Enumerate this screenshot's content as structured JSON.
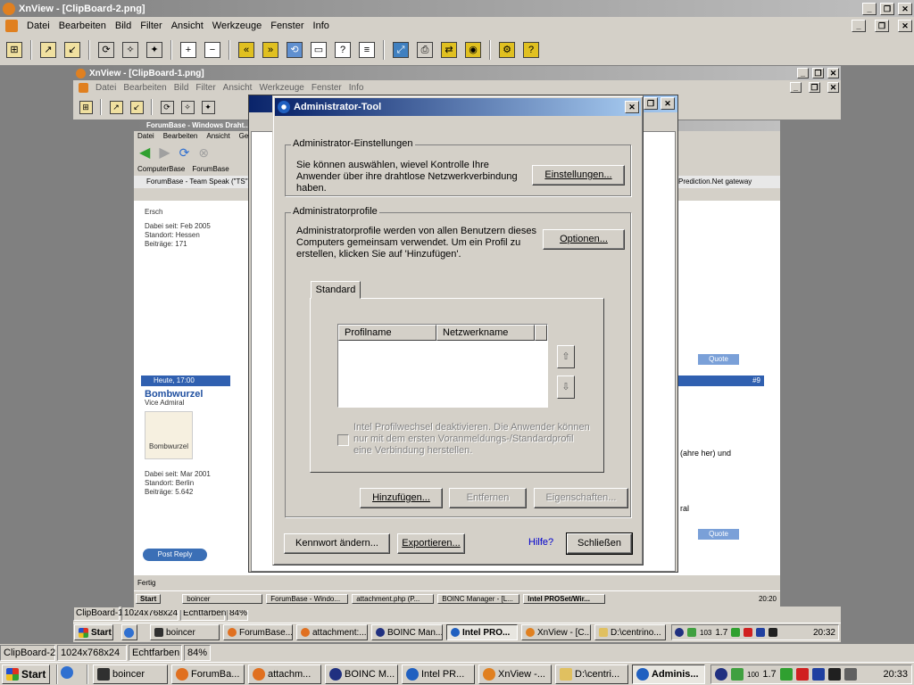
{
  "outer": {
    "title": "XnView - [ClipBoard-2.png]",
    "menu": [
      "Datei",
      "Bearbeiten",
      "Bild",
      "Filter",
      "Ansicht",
      "Werkzeuge",
      "Fenster",
      "Info"
    ],
    "status": [
      "ClipBoard-2",
      "1024x768x24",
      "Echtfarben",
      "84%"
    ]
  },
  "mid": {
    "title": "XnView - [ClipBoard-1.png]",
    "menu": [
      "Datei",
      "Bearbeiten",
      "Bild",
      "Filter",
      "Ansicht",
      "Werkzeuge",
      "Fenster",
      "Info"
    ],
    "status": [
      "ClipBoard-1",
      "1024x768x24",
      "Echtfarben",
      "84%"
    ]
  },
  "inner": {
    "browser_title": "ForumBase - Windows Draht...",
    "menu": [
      "Datei",
      "Bearbeiten",
      "Ansicht",
      "Gehe"
    ],
    "bookmarks": [
      "ComputerBase",
      "ForumBase"
    ],
    "tab": "ForumBase - Team Speak (\"TS\") - ...",
    "tab_right": "Prediction.Net gateway",
    "user1": {
      "name": "Ersch",
      "joined": "Dabei seit: Feb 2005",
      "location": "Standort: Hessen",
      "posts": "Beiträge: 171"
    },
    "post_time": "Heute, 17:00",
    "user2": {
      "name": "Bombwurzel",
      "rank": "Vice Admiral",
      "avatar": "Bombwurzel",
      "joined": "Dabei seit: Mar 2001",
      "location": "Standort: Berlin",
      "posts": "Beiträge: 5.642"
    },
    "post_reply": "Post Reply",
    "quote": "Quote",
    "post_num": "#9",
    "text_right1": "(ahre her) und",
    "text_right2": "ral",
    "status": "Fertig",
    "tasks": [
      "Start",
      "boincer",
      "ForumBase - Windo...",
      "attachment.php (P...",
      "BOINC Manager - [L...",
      "Intel PROSet/Wir..."
    ],
    "clock": "20:20"
  },
  "dialog": {
    "title": "Administrator-Tool",
    "group1": {
      "legend": "Administrator-Einstellungen",
      "text": "Sie können auswählen, wievel Kontrolle Ihre Anwender über ihre drahtlose Netzwerkverbindung haben.",
      "button": "Einstellungen..."
    },
    "group2": {
      "legend": "Administratorprofile",
      "text": "Administratorprofile werden von allen Benutzern dieses Computers gemeinsam verwendet. Um ein Profil zu erstellen, klicken Sie auf 'Hinzufügen'.",
      "button": "Optionen..."
    },
    "tab": "Standard",
    "columns": [
      "Profilname",
      "Netzwerkname"
    ],
    "checkbox": "Intel Profilwechsel deaktivieren. Die Anwender können nur mit dem ersten Voranmeldungs-/Standardprofil eine Verbindung herstellen.",
    "buttons": {
      "add": "Hinzufügen...",
      "remove": "Entfernen",
      "properties": "Eigenschaften..."
    },
    "footer": {
      "password": "Kennwort ändern...",
      "export": "Exportieren...",
      "help": "Hilfe?",
      "close": "Schließen"
    }
  },
  "taskbar_mid": {
    "items": [
      "Start",
      "boincer",
      "ForumBase...",
      "attachment:...",
      "BOINC Man...",
      "Intel PRO...",
      "XnView - [C...",
      "D:\\centrino..."
    ],
    "tray": "1.7",
    "tray_num": "103",
    "clock": "20:32"
  },
  "taskbar": {
    "items": [
      "Start",
      "boincer",
      "ForumBa...",
      "attachm...",
      "BOINC M...",
      "Intel PR...",
      "XnView -...",
      "D:\\centri...",
      "Adminis..."
    ],
    "tray": "1.7",
    "tray_num": "100",
    "clock": "20:33"
  },
  "colors": {
    "title_active": "#0a246a",
    "face": "#d4d0c8",
    "xp_blue": "#3169c6"
  }
}
